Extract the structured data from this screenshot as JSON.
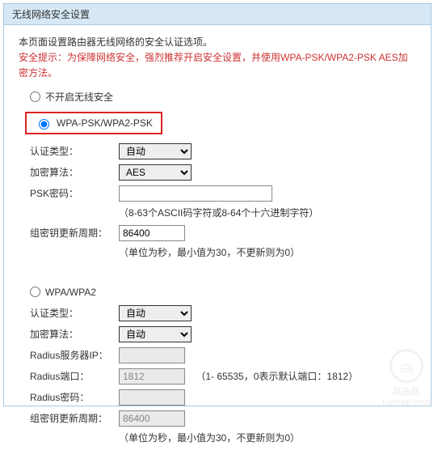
{
  "title": "无线网络安全设置",
  "intro1": "本页面设置路由器无线网络的安全认证选项。",
  "warn": "安全提示：为保障网络安全，强烈推荐开启安全设置，并使用WPA-PSK/WPA2-PSK AES加密方法。",
  "radios": {
    "noSecurity": "不开启无线安全",
    "wpaPsk": "WPA-PSK/WPA2-PSK",
    "wpa": "WPA/WPA2"
  },
  "sectionPsk": {
    "authLabel": "认证类型：",
    "authOptions": [
      "自动"
    ],
    "encryptLabel": "加密算法：",
    "encryptOptions": [
      "AES"
    ],
    "pskLabel": "PSK密码：",
    "pskValue": "",
    "pskHint": "（8-63个ASCII码字符或8-64个十六进制字符）",
    "groupKeyLabel": "组密钥更新周期：",
    "groupKeyValue": "86400",
    "groupKeyHint": "（单位为秒，最小值为30，不更新则为0）"
  },
  "sectionWpa": {
    "authLabel": "认证类型：",
    "authOptions": [
      "自动"
    ],
    "encryptLabel": "加密算法：",
    "encryptOptions": [
      "自动"
    ],
    "radiusIpLabel": "Radius服务器IP：",
    "radiusIpValue": "",
    "radiusPortLabel": "Radius端口：",
    "radiusPortValue": "1812",
    "radiusPortHint": "（1- 65535，0表示默认端口：1812）",
    "radiusPwdLabel": "Radius密码：",
    "radiusPwdValue": "",
    "groupKeyLabel": "组密钥更新周期：",
    "groupKeyValue": "86400",
    "groupKeyHint": "（单位为秒，最小值为30，不更新则为0）"
  },
  "watermark": {
    "text1": "路由器",
    "text2": "luyouqi.com"
  }
}
